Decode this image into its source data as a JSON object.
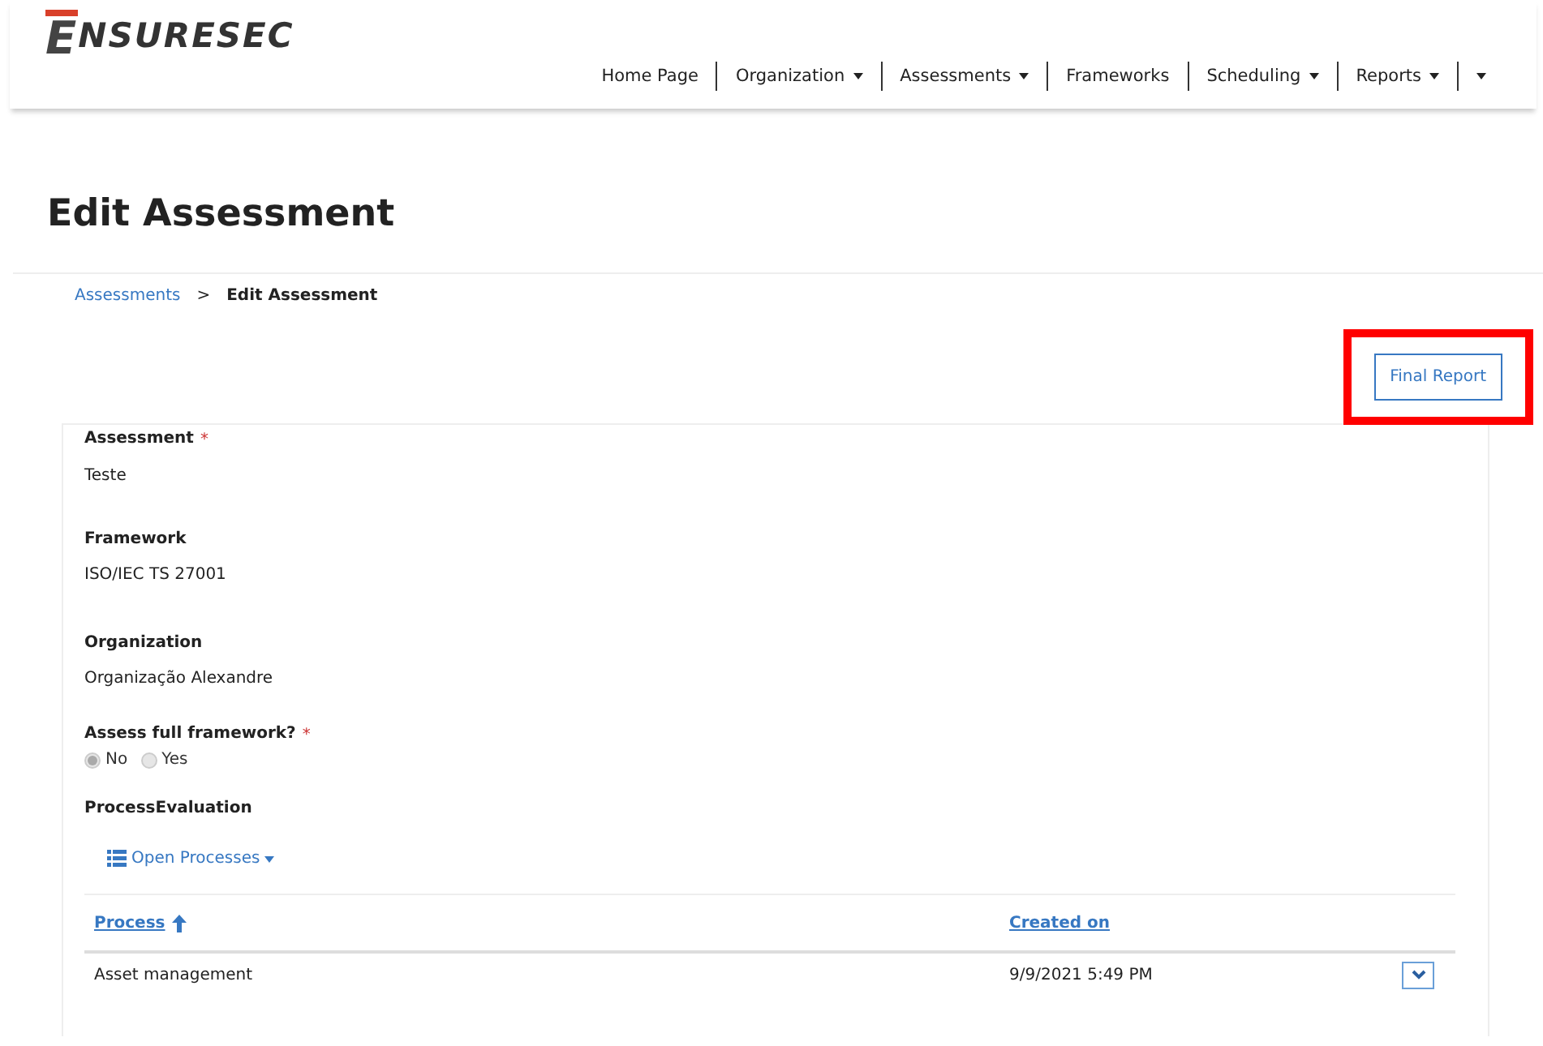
{
  "brand": {
    "logo_letter": "E",
    "logo_rest": "NSURESEC"
  },
  "nav": [
    {
      "label": "Home Page",
      "dropdown": false
    },
    {
      "label": "Organization",
      "dropdown": true
    },
    {
      "label": "Assessments",
      "dropdown": true
    },
    {
      "label": "Frameworks",
      "dropdown": false
    },
    {
      "label": "Scheduling",
      "dropdown": true
    },
    {
      "label": "Reports",
      "dropdown": true
    },
    {
      "dropdown": true
    }
  ],
  "page_title": "Edit Assessment",
  "breadcrumb": [
    {
      "label": "Assessments",
      "selected": false
    },
    {
      "label": "Edit Assessment",
      "selected": true
    }
  ],
  "breadcrumb_separator": ">",
  "final_report_button": {
    "label": "Final Report",
    "highlighted": true
  },
  "fields": [
    {
      "label": "Assessment",
      "required_mark": "*",
      "value": "Teste"
    },
    {
      "label": "Framework",
      "value": "ISO/IEC TS 27001"
    },
    {
      "label": "Organization",
      "value": "Organização Alexandre"
    }
  ],
  "assess_full": {
    "label": "Assess full framework?",
    "required_mark": "*",
    "options": [
      {
        "label": "No",
        "selected": true,
        "disabled": true
      },
      {
        "label": "Yes",
        "selected": false,
        "disabled": true
      }
    ]
  },
  "process_evaluation": {
    "label": "ProcessEvaluation",
    "menu_button": "Open Processes",
    "columns": [
      {
        "label": "Process",
        "sorted": true
      },
      {
        "label": "Created on",
        "sorted": false
      }
    ],
    "rows": [
      {
        "process": "Asset management",
        "created_on": "9/9/2021 5:49 PM"
      }
    ]
  }
}
